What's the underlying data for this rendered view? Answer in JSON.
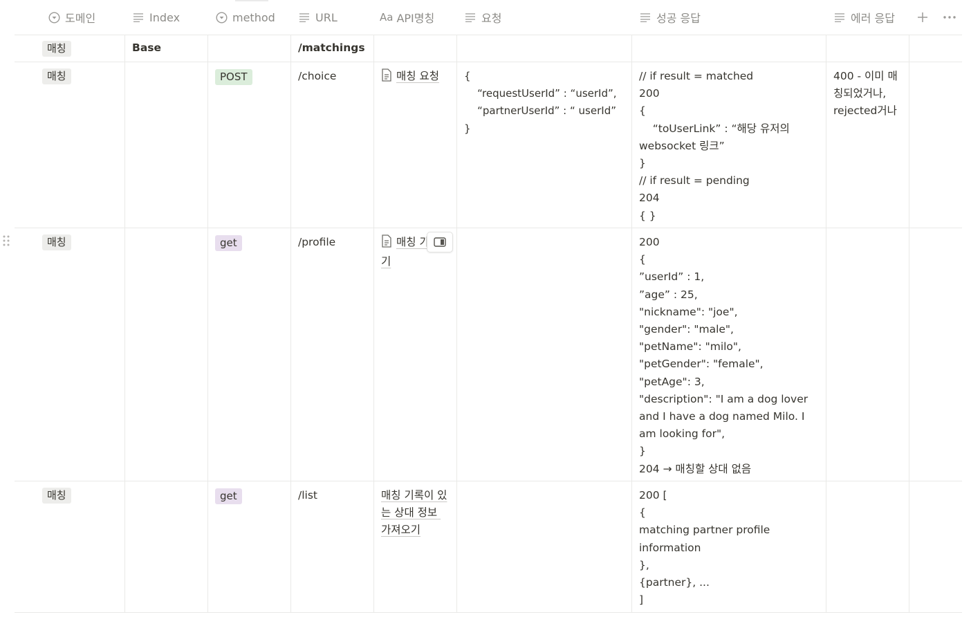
{
  "columns": [
    {
      "label": "도메인",
      "icon": "select-icon"
    },
    {
      "label": "Index",
      "icon": "text-icon"
    },
    {
      "label": "method",
      "icon": "select-icon"
    },
    {
      "label": "URL",
      "icon": "text-icon"
    },
    {
      "label": "API명칭",
      "icon": "title-icon",
      "icon_text": "Aa"
    },
    {
      "label": "요청",
      "icon": "text-icon"
    },
    {
      "label": "성공 응답",
      "icon": "text-icon"
    },
    {
      "label": "에러 응답",
      "icon": "text-icon"
    }
  ],
  "rows": [
    {
      "domain": "매칭",
      "index": "Base",
      "method": "",
      "url": "/matchings",
      "name": "",
      "request": "",
      "success": "",
      "error": ""
    },
    {
      "domain": "매칭",
      "index": "",
      "method": "POST",
      "url": "/choice",
      "name": "매칭 요청",
      "request": "{\n    “requestUserId” : “userId”,\n    “partnerUserId” : “ userId”\n}",
      "success": "// if result = matched\n200\n{\n    “toUserLink” : “해당 유저의 websocket 링크”\n}\n// if result = pending\n204\n{ }",
      "error": "400 - 이미 매칭되었거나, rejected거나"
    },
    {
      "domain": "매칭",
      "index": "",
      "method": "get",
      "url": "/profile",
      "name": "매칭 가져오기",
      "request": "",
      "success": "200\n{\n”userId” : 1,\n”age” : 25,\n\"nickname\": \"joe\",\n\"gender\": \"male\",\n\"petName\": \"milo\",\n\"petGender\": \"female\",\n\"petAge\": 3,\n\"description\": \"I am a dog lover and I have a dog named Milo. I am looking for\",\n}\n204 → 매칭할 상대 없음",
      "error": ""
    },
    {
      "domain": "매칭",
      "index": "",
      "method": "get",
      "url": "/list",
      "name": "매칭 기록이 있는 상대 정보 가져오기",
      "request": "",
      "success": "200 [\n{\nmatching partner profile information\n},\n{partner}, ...\n]",
      "error": ""
    }
  ],
  "colors": {
    "post_tag": "#dbeddb",
    "get_tag": "#e8deee",
    "domain_tag": "#ededeb",
    "border": "#e9e9e7",
    "header_text": "#8c8b87"
  }
}
